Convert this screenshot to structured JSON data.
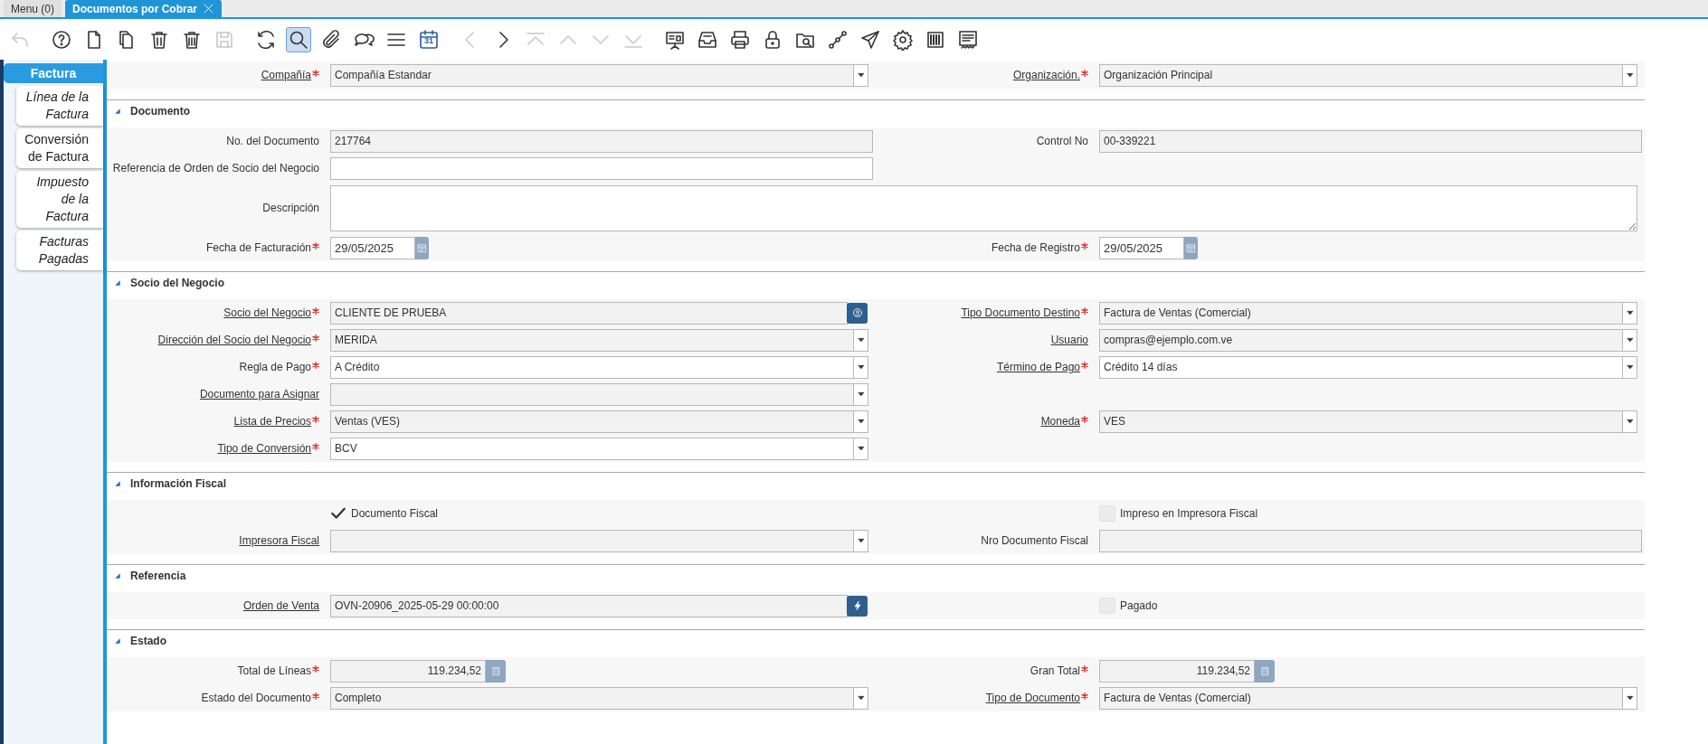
{
  "window_tabs": [
    {
      "label": "Menu (0)",
      "selected": false,
      "closable": false
    },
    {
      "label": "Documentos por Cobrar",
      "selected": true,
      "closable": true
    }
  ],
  "toolbar": [
    {
      "disabled": true,
      "selected": false
    },
    {
      "disabled": false,
      "selected": false
    },
    {
      "disabled": false,
      "selected": false
    },
    {
      "disabled": false,
      "selected": false
    },
    {
      "disabled": false,
      "selected": false
    },
    {
      "disabled": false,
      "selected": false
    },
    {
      "disabled": true,
      "selected": false
    },
    {
      "disabled": false,
      "selected": false
    },
    {
      "disabled": false,
      "selected": true
    },
    {
      "disabled": false,
      "selected": false
    },
    {
      "disabled": false,
      "selected": false
    },
    {
      "disabled": false,
      "selected": false
    },
    {
      "disabled": false,
      "selected": false,
      "label": "31"
    },
    {
      "disabled": true,
      "selected": false
    },
    {
      "disabled": false,
      "selected": false
    },
    {
      "disabled": true,
      "selected": false
    },
    {
      "disabled": true,
      "selected": false
    },
    {
      "disabled": true,
      "selected": false
    },
    {
      "disabled": true,
      "selected": false
    },
    {
      "disabled": false,
      "selected": false
    },
    {
      "disabled": false,
      "selected": false
    },
    {
      "disabled": false,
      "selected": false
    },
    {
      "disabled": false,
      "selected": false
    },
    {
      "disabled": false,
      "selected": false
    },
    {
      "disabled": false,
      "selected": false
    },
    {
      "disabled": false,
      "selected": false
    },
    {
      "disabled": false,
      "selected": false
    },
    {
      "disabled": false,
      "selected": false
    },
    {
      "disabled": false,
      "selected": false
    }
  ],
  "side_tabs": [
    {
      "label": "Factura",
      "selected": true,
      "italic": false
    },
    {
      "label": "Línea de la Factura",
      "selected": false,
      "italic": true
    },
    {
      "label": "Conversión de Factura",
      "selected": false,
      "italic": false
    },
    {
      "label": "Impuesto de la Factura",
      "selected": false,
      "italic": true
    },
    {
      "label": "Facturas Pagadas",
      "selected": false,
      "italic": true
    }
  ],
  "header_rows": [
    {
      "left": {
        "label": "Compañía",
        "link": true,
        "mandatory": true,
        "kind": "combo",
        "value": "Compañía Estandar",
        "readonly": true
      },
      "right": {
        "label": "Organización.",
        "link": true,
        "mandatory": true,
        "kind": "combo",
        "value": "Organización Principal",
        "readonly": true
      }
    }
  ],
  "sections": [
    {
      "title": "Documento",
      "expanded": true,
      "rows": [
        {
          "left": {
            "label": "No. del Documento",
            "link": false,
            "mandatory": false,
            "kind": "text",
            "value": "217764",
            "readonly": true
          },
          "right": {
            "label": "Control No",
            "link": false,
            "mandatory": false,
            "kind": "text",
            "value": "00-339221",
            "readonly": true
          }
        },
        {
          "left": {
            "label": "Referencia de Orden de Socio del Negocio",
            "link": false,
            "mandatory": false,
            "kind": "text",
            "readonly": false
          }
        },
        {
          "left": {
            "label": "Descripción",
            "link": false,
            "mandatory": false,
            "kind": "textarea",
            "readonly": false
          }
        },
        {
          "left": {
            "label": "Fecha de Facturación",
            "link": false,
            "mandatory": true,
            "kind": "date",
            "value": "29/05/2025",
            "readonly": false
          },
          "right": {
            "label": "Fecha de Registro",
            "link": false,
            "mandatory": true,
            "kind": "date",
            "value": "29/05/2025",
            "readonly": false
          }
        }
      ]
    },
    {
      "title": "Socio del Negocio",
      "expanded": true,
      "rows": [
        {
          "left": {
            "label": "Socio del Negocio",
            "link": true,
            "mandatory": true,
            "kind": "search",
            "value": "CLIENTE DE PRUEBA",
            "readonly": true
          },
          "right": {
            "label": "Tipo Documento Destino",
            "link": true,
            "mandatory": true,
            "kind": "combo",
            "value": "Factura de Ventas (Comercial)",
            "readonly": true
          }
        },
        {
          "left": {
            "label": "Dirección del Socio del Negocio",
            "link": true,
            "mandatory": true,
            "kind": "combo",
            "value": "MERIDA",
            "readonly": true
          },
          "right": {
            "label": "Usuario",
            "link": true,
            "mandatory": false,
            "kind": "combo",
            "value": "compras@ejemplo.com.ve",
            "readonly": true
          }
        },
        {
          "left": {
            "label": "Regla de Pago",
            "link": false,
            "mandatory": true,
            "kind": "combo",
            "value": "A Crédito",
            "readonly": false
          },
          "right": {
            "label": "Término de Pago",
            "link": true,
            "mandatory": true,
            "kind": "combo",
            "value": "Crédito 14 días",
            "readonly": false
          }
        },
        {
          "left": {
            "label": "Documento para Asignar",
            "link": true,
            "mandatory": false,
            "kind": "combo",
            "readonly": true
          }
        },
        {
          "left": {
            "label": "Lista de Precios",
            "link": true,
            "mandatory": true,
            "kind": "combo",
            "value": "Ventas (VES)",
            "readonly": true
          },
          "right": {
            "label": "Moneda",
            "link": true,
            "mandatory": true,
            "kind": "combo",
            "value": "VES",
            "readonly": true
          }
        },
        {
          "left": {
            "label": "Tipo de Conversión",
            "link": true,
            "mandatory": true,
            "kind": "combo",
            "value": "BCV",
            "readonly": false
          }
        }
      ]
    },
    {
      "title": "Información Fiscal",
      "expanded": true,
      "rows": [
        {
          "left": {
            "label": "Documento Fiscal",
            "kind": "checkbox",
            "checked": true,
            "readonly": false
          },
          "right": {
            "label": "Impreso en Impresora Fiscal",
            "kind": "checkbox",
            "checked": false,
            "readonly": true
          }
        },
        {
          "left": {
            "label": "Impresora Fiscal",
            "link": true,
            "mandatory": false,
            "kind": "combo",
            "readonly": true
          },
          "right": {
            "label": "Nro Documento Fiscal",
            "link": false,
            "mandatory": false,
            "kind": "text",
            "readonly": true
          }
        }
      ]
    },
    {
      "title": "Referencia",
      "expanded": true,
      "rows": [
        {
          "left": {
            "label": "Orden de Venta",
            "link": true,
            "mandatory": false,
            "kind": "zoom",
            "value": "OVN-20906_2025-05-29 00:00:00",
            "readonly": true
          },
          "right": {
            "label": "Pagado",
            "kind": "checkbox",
            "checked": false,
            "readonly": true
          }
        }
      ]
    },
    {
      "title": "Estado",
      "expanded": true,
      "rows": [
        {
          "left": {
            "label": "Total de Líneas",
            "link": false,
            "mandatory": true,
            "kind": "amount",
            "value": "119.234,52",
            "readonly": true
          },
          "right": {
            "label": "Gran Total",
            "link": false,
            "mandatory": true,
            "kind": "amount",
            "value": "119.234,52",
            "readonly": true
          }
        },
        {
          "left": {
            "label": "Estado del Documento",
            "link": false,
            "mandatory": true,
            "kind": "combo",
            "value": "Completo",
            "readonly": true
          },
          "right": {
            "label": "Tipo de Documento",
            "link": true,
            "mandatory": true,
            "kind": "combo",
            "value": "Factura de Ventas (Comercial)",
            "readonly": true
          }
        }
      ]
    }
  ]
}
